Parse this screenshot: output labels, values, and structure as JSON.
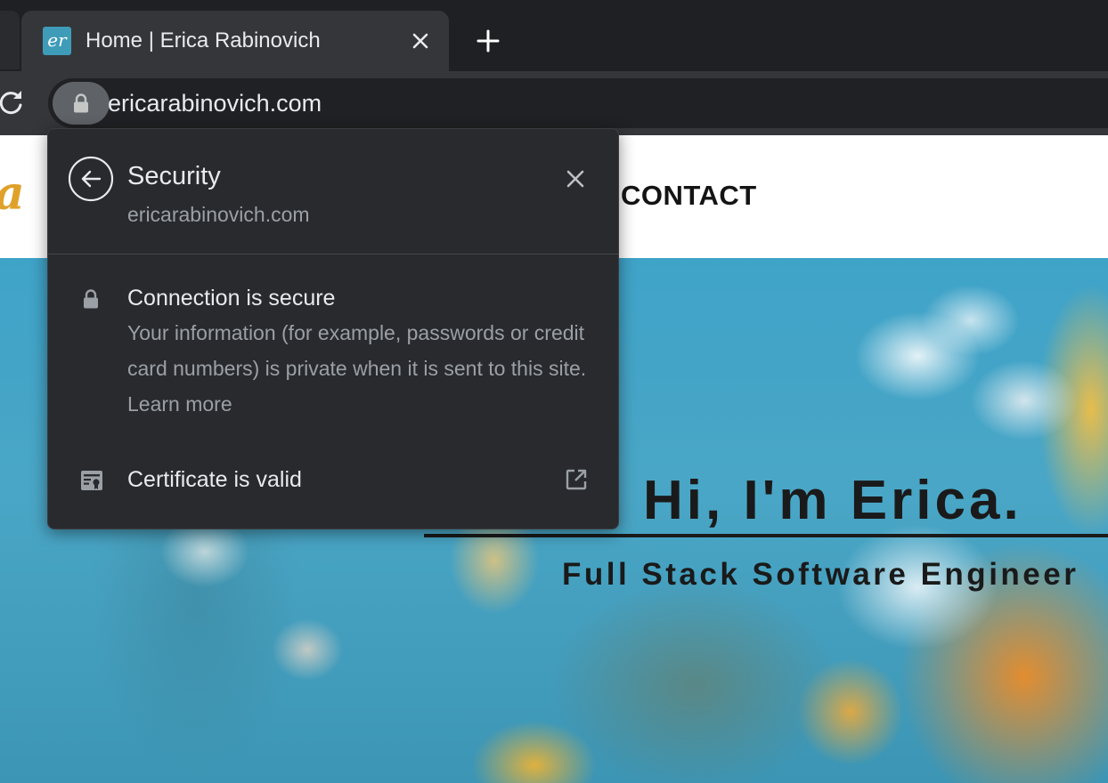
{
  "browser": {
    "tab": {
      "favicon_text": "er",
      "title": "Home | Erica Rabinovich"
    },
    "address_bar": {
      "url": "ericarabinovich.com"
    },
    "icons": {
      "tab_close": "close-icon",
      "new_tab": "plus-icon",
      "reload": "reload-icon",
      "site_info": "lock-icon"
    }
  },
  "page": {
    "logo_fragment": "a",
    "nav": {
      "contact": "CONTACT"
    },
    "hero": {
      "title": "Hi, I'm Erica.",
      "subtitle": "Full Stack Software Engineer"
    }
  },
  "security_popup": {
    "title": "Security",
    "domain": "ericarabinovich.com",
    "connection": {
      "title": "Connection is secure",
      "description": "Your information (for example, passwords or credit card numbers) is private when it is sent to this site.",
      "learn_more": "Learn more"
    },
    "certificate": {
      "label": "Certificate is valid"
    }
  },
  "colors": {
    "chrome_dark": "#1f2023",
    "toolbar": "#35363a",
    "popup_bg": "#292a2d",
    "text_primary": "#e8eaed",
    "text_secondary": "#9aa0a6",
    "favicon_bg": "#3e9cb8",
    "logo_accent": "#e0a12a"
  }
}
